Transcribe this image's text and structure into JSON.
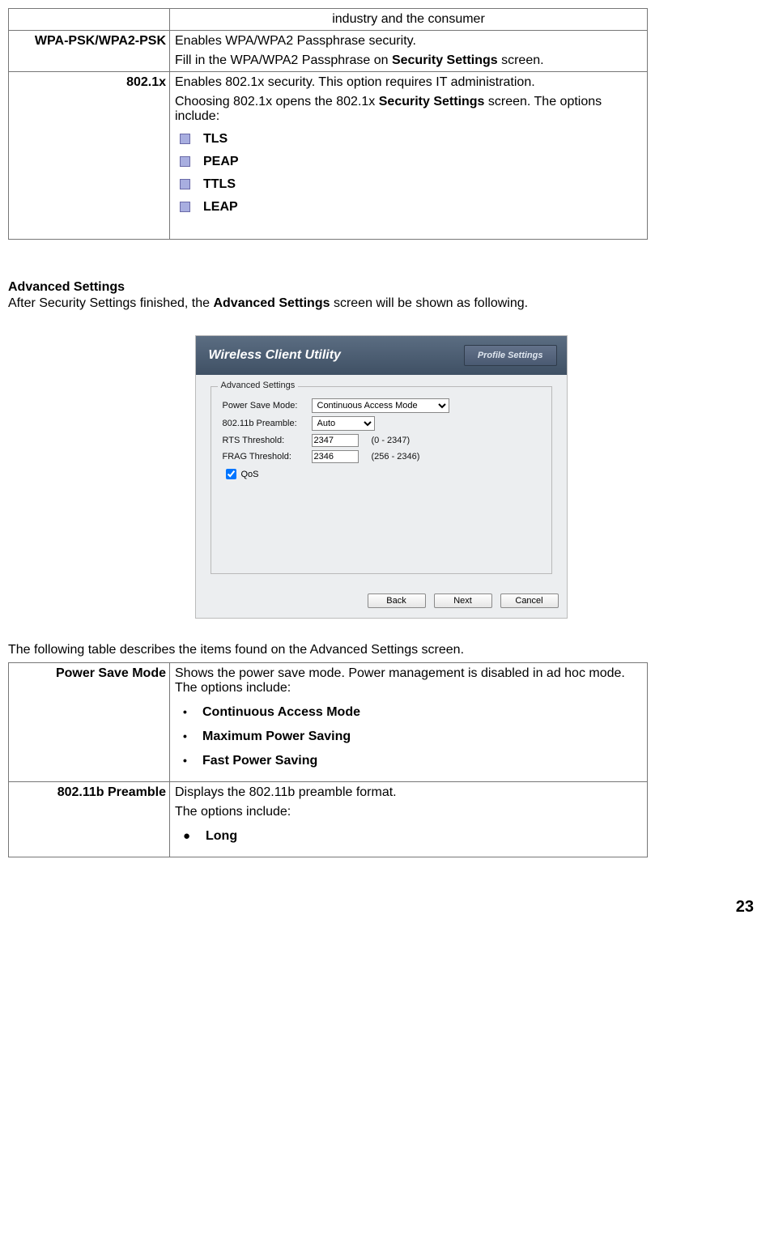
{
  "table1": {
    "row0": {
      "label": "",
      "text": "industry and the consumer"
    },
    "row1": {
      "label": "WPA-PSK/WPA2-PSK",
      "line1": "Enables WPA/WPA2 Passphrase security.",
      "line2_a": "Fill in the WPA/WPA2 Passphrase on ",
      "line2_b": "Security Settings",
      "line2_c": " screen."
    },
    "row2": {
      "label": "802.1x",
      "line1": "Enables 802.1x security.   This option requires IT administration.",
      "line2_a": "Choosing 802.1x opens the 802.1x ",
      "line2_b": "Security Settings",
      "line2_c": " screen. The options include:",
      "opts": [
        "TLS",
        "PEAP",
        "TTLS",
        "LEAP"
      ]
    }
  },
  "adv": {
    "heading": "Advanced Settings",
    "para_a": "After Security Settings finished, the ",
    "para_b": "Advanced Settings",
    "para_c": " screen will be shown as following."
  },
  "shot": {
    "title": "Wireless Client Utility",
    "tab": "Profile Settings",
    "legend": "Advanced Settings",
    "labels": {
      "psm": "Power Save Mode:",
      "pre": "802.11b Preamble:",
      "rts": "RTS Threshold:",
      "frag": "FRAG Threshold:",
      "qos": "QoS"
    },
    "values": {
      "psm": "Continuous Access Mode",
      "pre": "Auto",
      "rts": "2347",
      "frag": "2346"
    },
    "hints": {
      "rts": "(0 - 2347)",
      "frag": "(256 - 2346)"
    },
    "buttons": {
      "back": "Back",
      "next": "Next",
      "cancel": "Cancel"
    }
  },
  "tabledesc_intro": "The following table describes the items found on the Advanced Settings screen.",
  "table2": {
    "row0": {
      "label": "Power Save Mode",
      "line1": "Shows the power save mode. Power management is disabled in ad hoc mode. The options include:",
      "opts": [
        "Continuous Access Mode",
        "Maximum Power Saving",
        "Fast Power Saving"
      ]
    },
    "row1": {
      "label": "802.11b Preamble",
      "line1": "Displays the 802.11b preamble format.",
      "line2": "The options include:",
      "opts": [
        "Long"
      ]
    }
  },
  "pagenum": "23"
}
